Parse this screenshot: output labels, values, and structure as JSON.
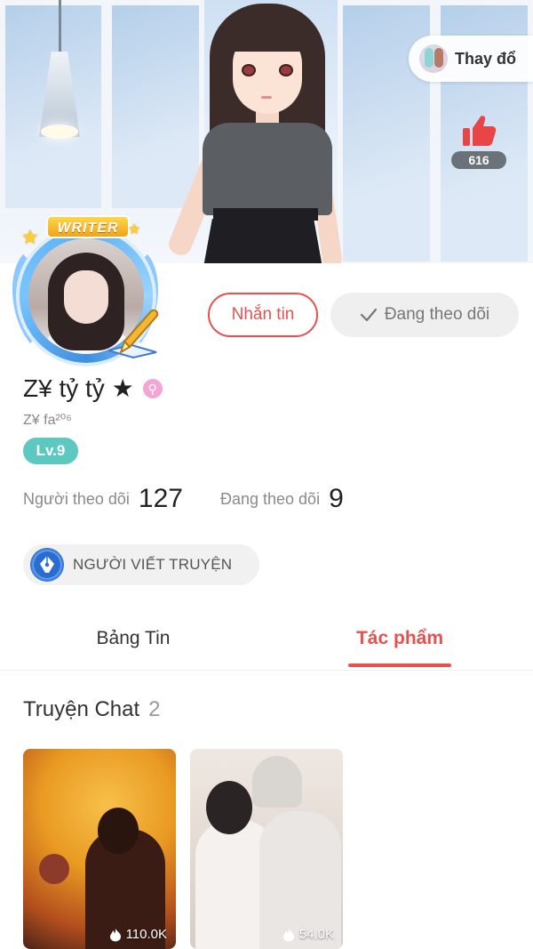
{
  "header": {
    "change_outfit_label": "Thay đổ",
    "likes": "616"
  },
  "profile": {
    "badge_label": "WRITER",
    "name": "Z¥ tỷ tỷ ★",
    "handle": "Z¥ fa²⁰⁶",
    "level": "Lv.9",
    "message_button": "Nhắn tin",
    "following_button": "Đang theo dõi",
    "gender_symbol": "⚲",
    "stats": {
      "followers_label": "Người theo dõi",
      "followers_value": "127",
      "following_label": "Đang theo dõi",
      "following_value": "9"
    },
    "role_label": "NGƯỜI VIẾT TRUYỆN"
  },
  "tabs": [
    {
      "label": "Bảng Tin",
      "active": false
    },
    {
      "label": "Tác phẩm",
      "active": true
    }
  ],
  "section": {
    "title": "Truyện Chat",
    "count": "2"
  },
  "stories": [
    {
      "views": "110.0K"
    },
    {
      "views": "54.0K"
    }
  ],
  "colors": {
    "accent": "#e8504f",
    "level_badge": "#5cc8c0",
    "role_icon": "#2a6cd0"
  }
}
